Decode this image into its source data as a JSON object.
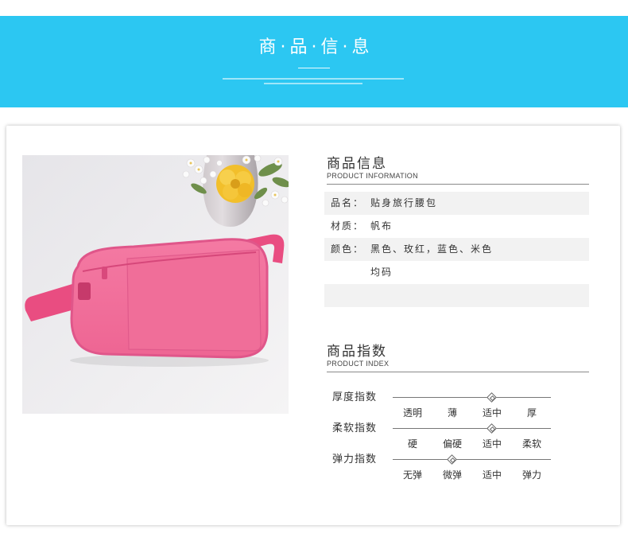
{
  "banner": {
    "title": "商·品·信·息",
    "color": "#2cc7f2"
  },
  "info": {
    "heading": "商品信息",
    "subheading": "PRODUCT INFORMATION",
    "rows": [
      {
        "label": "品名：",
        "value": "贴身旅行腰包"
      },
      {
        "label": "材质：",
        "value": "帆布"
      },
      {
        "label": "颜色：",
        "value": "黑色、玫红，蓝色、米色"
      },
      {
        "label": "",
        "value": "均码"
      },
      {
        "label": "",
        "value": ""
      }
    ]
  },
  "index": {
    "heading": "商品指数",
    "subheading": "PRODUCT INDEX",
    "rows": [
      {
        "label": "厚度指数",
        "options": [
          "透明",
          "薄",
          "适中",
          "厚"
        ],
        "selected": "适中"
      },
      {
        "label": "柔软指数",
        "options": [
          "硬",
          "偏硬",
          "适中",
          "柔软"
        ],
        "selected": "适中"
      },
      {
        "label": "弹力指数",
        "options": [
          "无弹",
          "微弹",
          "适中",
          "弹力"
        ],
        "selected": "微弹"
      }
    ]
  }
}
